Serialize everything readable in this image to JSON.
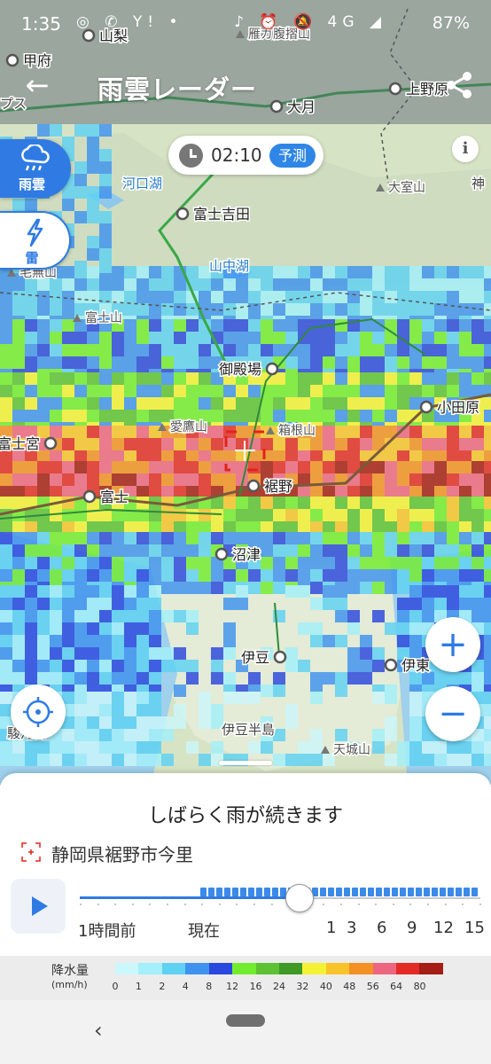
{
  "status_bar": {
    "time": "1:35",
    "left_icons": "◎ ✆ Y! •",
    "right_icons": "♪ ⏰ 🔕 4G ◢",
    "battery": "87%"
  },
  "app_bar": {
    "title": "雨雲レーダー",
    "back_icon": "arrow-left-icon",
    "share_icon": "share-icon"
  },
  "time_chip": {
    "time": "02:10",
    "badge": "予測"
  },
  "info_label": "i",
  "layers": [
    {
      "label": "雨雲",
      "icon": "rain-cloud-icon",
      "active": true
    },
    {
      "label": "雷",
      "icon": "lightning-icon",
      "active": false
    }
  ],
  "map": {
    "cities": [
      {
        "name": "甲府"
      },
      {
        "name": "山梨"
      },
      {
        "name": "大月"
      },
      {
        "name": "上野原"
      },
      {
        "name": "富士吉田"
      },
      {
        "name": "御殿場"
      },
      {
        "name": "小田原"
      },
      {
        "name": "富士宮"
      },
      {
        "name": "富士"
      },
      {
        "name": "裾野"
      },
      {
        "name": "沼津"
      },
      {
        "name": "伊豆"
      },
      {
        "name": "伊東"
      }
    ],
    "water": [
      {
        "name": "河口湖"
      },
      {
        "name": "山中湖"
      }
    ],
    "peaks": [
      {
        "name": "雁ガ腹摺山"
      },
      {
        "name": "大室山"
      },
      {
        "name": "毛無山"
      },
      {
        "name": "富士山"
      },
      {
        "name": "愛鷹山"
      },
      {
        "name": "箱根山"
      },
      {
        "name": "天城山"
      }
    ],
    "regions": [
      {
        "name": "伊豆半島"
      },
      {
        "name": "駿河湾"
      },
      {
        "name": "神"
      },
      {
        "name": "プス"
      }
    ]
  },
  "controls": {
    "zoom_in": "+",
    "zoom_out": "−",
    "locate_icon": "crosshair-icon"
  },
  "sheet": {
    "headline": "しばらく雨が続きます",
    "location": "静岡県裾野市今里",
    "timeline_labels": {
      "past": "1時間前",
      "now": "現在",
      "h1": "1",
      "h3": "3",
      "h6": "6",
      "h9": "9",
      "h12": "12",
      "h15": "15"
    },
    "current_position": 0.548
  },
  "legend": {
    "title": "降水量",
    "unit": "(mm/h)",
    "colors": [
      "#ccf7fb",
      "#a3f0fa",
      "#5fd2f3",
      "#3f93ef",
      "#2a47de",
      "#72ed2e",
      "#5cc233",
      "#3e9925",
      "#f4f235",
      "#f9c42b",
      "#f39124",
      "#ed6580",
      "#e32b25",
      "#a51d14"
    ],
    "values": [
      "0",
      "1",
      "2",
      "4",
      "8",
      "12",
      "16",
      "24",
      "32",
      "40",
      "48",
      "56",
      "64",
      "80"
    ]
  }
}
